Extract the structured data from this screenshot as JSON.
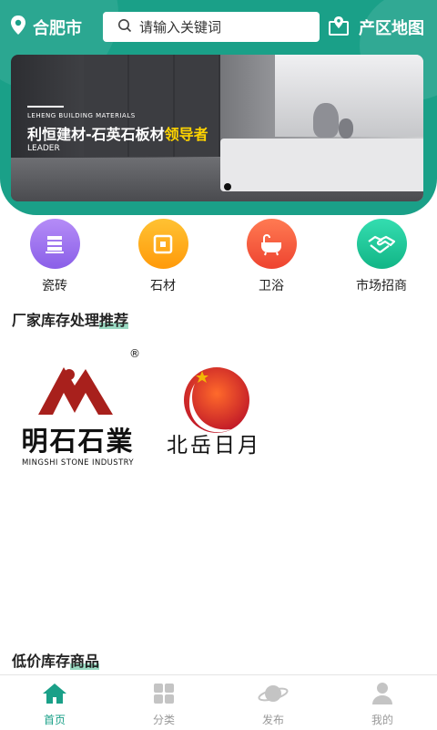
{
  "header": {
    "city": "合肥市",
    "search_placeholder": "请输入关键词",
    "map_label": "产区地图"
  },
  "banner": {
    "subtitle": "LEHENG BUILDING MATERIALS",
    "headline_main": "利恒建材-石英石板材",
    "headline_highlight": "领导者",
    "tagline": "LEADER",
    "active_slide": 1,
    "slide_count": 1
  },
  "categories": [
    {
      "label": "瓷砖",
      "icon": "tile-stack-icon",
      "color": "#9d72f0"
    },
    {
      "label": "石材",
      "icon": "stone-square-icon",
      "color": "#ffa21a"
    },
    {
      "label": "卫浴",
      "icon": "bathtub-icon",
      "color": "#f4553a"
    },
    {
      "label": "市场招商",
      "icon": "handshake-icon",
      "color": "#20c997"
    }
  ],
  "sections": {
    "stock_title_prefix": "厂家库存处理",
    "stock_title_highlight": "推荐",
    "lowprice_title_prefix": "低价库存",
    "lowprice_title_highlight": "商品"
  },
  "brands": [
    {
      "name": "明石石業",
      "subtitle": "MINGSHI STONE INDUSTRY",
      "mark": "®"
    },
    {
      "name": "北岳日月"
    }
  ],
  "tabbar": [
    {
      "label": "首页",
      "icon": "home-icon",
      "active": true
    },
    {
      "label": "分类",
      "icon": "grid-icon",
      "active": false
    },
    {
      "label": "发布",
      "icon": "planet-icon",
      "active": false
    },
    {
      "label": "我的",
      "icon": "user-icon",
      "active": false
    }
  ],
  "colors": {
    "brand": "#1aa088",
    "highlight": "#6ec9a8"
  }
}
